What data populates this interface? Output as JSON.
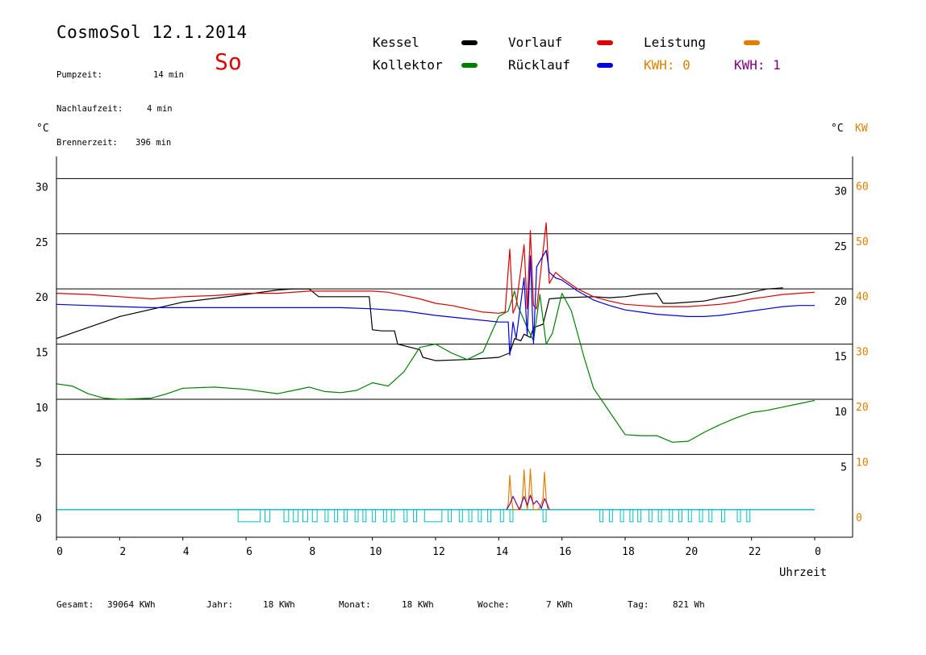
{
  "header": {
    "title": "CosmoSol 12.1.2014",
    "day": "So",
    "info": [
      {
        "label": "Pumpzeit:",
        "value": "14 min"
      },
      {
        "label": "Nachlaufzeit:",
        "value": "4 min"
      },
      {
        "label": "Brennerzeit:",
        "value": "396 min"
      }
    ]
  },
  "legend": {
    "kessel": "Kessel",
    "kollektor": "Kollektor",
    "vorlauf": "Vorlauf",
    "ruecklauf": "Rücklauf",
    "leistung": "Leistung",
    "kwh0": "KWH: 0",
    "kwh1": "KWH: 1"
  },
  "colors": {
    "kessel": "#000000",
    "kollektor": "#008000",
    "vorlauf": "#e00000",
    "ruecklauf": "#0000e0",
    "leistung": "#e08000",
    "kwh0": "#e08000",
    "kwh1": "#800080",
    "pump": "#00c0c0",
    "grid": "#000000"
  },
  "footer": {
    "gesamt_label": "Gesamt:",
    "gesamt_value": "39064 KWh",
    "jahr_label": "Jahr:",
    "jahr_value": "18 KWh",
    "monat_label": "Monat:",
    "monat_value": "18 KWh",
    "woche_label": "Woche:",
    "woche_value": "7 KWh",
    "tag_label": "Tag:",
    "tag_value": "821 Wh"
  },
  "chart_data": {
    "type": "line",
    "xlabel": "Uhrzeit",
    "ylabel_left": "°C",
    "ylabel_right": "°C",
    "ylabel_right2": "KW",
    "xlim": [
      0,
      24
    ],
    "ylim": [
      -2.5,
      32
    ],
    "x_ticks": [
      0,
      2,
      4,
      6,
      8,
      10,
      12,
      14,
      16,
      18,
      20,
      22,
      24
    ],
    "x_tick_labels": [
      "0",
      "2",
      "4",
      "6",
      "8",
      "10",
      "12",
      "14",
      "16",
      "18",
      "20",
      "22",
      "0"
    ],
    "y_ticks": [
      0,
      5,
      10,
      15,
      20,
      25,
      30
    ],
    "left_tick_labels": [
      "0",
      "5",
      "10",
      "15",
      "20",
      "25",
      "30"
    ],
    "right_tick_labels": [
      "",
      "5",
      "10",
      "15",
      "20",
      "25",
      "30"
    ],
    "kw_tick_labels": [
      "0",
      "10",
      "20",
      "30",
      "40",
      "50",
      "60"
    ],
    "grid": true,
    "series": [
      {
        "name": "Kessel",
        "key": "kessel",
        "x": [
          0,
          2,
          4,
          6,
          7,
          7.5,
          8,
          8.3,
          9,
          9.9,
          10,
          10.3,
          10.7,
          10.8,
          11.5,
          11.6,
          12,
          13,
          13.5,
          14,
          14.35,
          14.5,
          14.7,
          14.8,
          15,
          15.1,
          15.4,
          15.6,
          16,
          17,
          17.5,
          18,
          18.5,
          19,
          19.2,
          19.5,
          20,
          20.5,
          21,
          21.5,
          22,
          22.5,
          23
        ],
        "y": [
          15.5,
          17.5,
          18.8,
          19.5,
          19.9,
          20.0,
          20.0,
          19.3,
          19.3,
          19.3,
          16.3,
          16.2,
          16.2,
          15.0,
          14.5,
          13.8,
          13.5,
          13.6,
          13.7,
          13.8,
          14.2,
          15.5,
          15.3,
          15.9,
          15.6,
          16.5,
          16.8,
          19.1,
          19.2,
          19.3,
          19.2,
          19.3,
          19.5,
          19.6,
          18.7,
          18.7,
          18.8,
          18.9,
          19.2,
          19.4,
          19.7,
          20.0,
          20.1
        ]
      },
      {
        "name": "Kollektor",
        "key": "kollektor",
        "x": [
          0,
          0.5,
          1,
          1.5,
          2,
          3,
          3.5,
          4,
          5,
          6,
          7,
          7.5,
          8,
          8.5,
          9,
          9.5,
          10,
          10.5,
          11,
          11.5,
          12,
          12.5,
          13,
          13.5,
          14,
          14.3,
          14.5,
          14.6,
          14.9,
          15.1,
          15.3,
          15.5,
          15.7,
          16,
          16.3,
          16.7,
          17,
          17.5,
          18,
          18.5,
          19,
          19.5,
          20,
          20.5,
          21,
          21.5,
          22,
          22.5,
          23,
          23.5,
          24
        ],
        "y": [
          11.4,
          11.2,
          10.5,
          10.1,
          10.0,
          10.1,
          10.5,
          11.0,
          11.1,
          10.9,
          10.5,
          10.8,
          11.1,
          10.7,
          10.6,
          10.8,
          11.5,
          11.2,
          12.5,
          14.7,
          15.0,
          14.2,
          13.6,
          14.3,
          17.5,
          18.0,
          19.8,
          18.5,
          16.5,
          15.3,
          19.5,
          15.0,
          16.0,
          19.6,
          18.0,
          13.8,
          11.0,
          8.9,
          6.8,
          6.7,
          6.7,
          6.1,
          6.2,
          7.0,
          7.7,
          8.3,
          8.8,
          9.0,
          9.3,
          9.6,
          9.9
        ]
      },
      {
        "name": "Vorlauf",
        "key": "vorlauf",
        "x": [
          0,
          1,
          2,
          3,
          4,
          5,
          6,
          7,
          8,
          9,
          10,
          10.5,
          11,
          11.5,
          12,
          12.5,
          13,
          13.5,
          14,
          14.2,
          14.35,
          14.45,
          14.55,
          14.8,
          14.9,
          15.0,
          15.1,
          15.2,
          15.5,
          15.6,
          15.8,
          16,
          16.5,
          17,
          17.5,
          18,
          18.5,
          19,
          19.5,
          20,
          20.5,
          21,
          21.5,
          22,
          22.5,
          23,
          23.5,
          24
        ],
        "y": [
          19.6,
          19.5,
          19.3,
          19.1,
          19.3,
          19.4,
          19.6,
          19.6,
          19.8,
          19.8,
          19.8,
          19.7,
          19.4,
          19.1,
          18.7,
          18.5,
          18.2,
          17.9,
          17.8,
          17.9,
          23.6,
          17.8,
          18.5,
          24.0,
          18.2,
          25.3,
          18.5,
          18.2,
          26.0,
          20.5,
          21.5,
          21.0,
          20.0,
          19.3,
          18.9,
          18.6,
          18.5,
          18.4,
          18.4,
          18.4,
          18.5,
          18.6,
          18.8,
          19.1,
          19.3,
          19.5,
          19.6,
          19.7
        ]
      },
      {
        "name": "Rücklauf",
        "key": "ruecklauf",
        "x": [
          0,
          1,
          2,
          3,
          4,
          5,
          6,
          7,
          8,
          9,
          10,
          11,
          12,
          13,
          14,
          14.3,
          14.35,
          14.45,
          14.55,
          14.8,
          14.9,
          15.0,
          15.1,
          15.2,
          15.5,
          15.6,
          15.8,
          16,
          16.5,
          17,
          17.5,
          18,
          18.5,
          19,
          19.5,
          20,
          20.5,
          21,
          21.5,
          22,
          22.5,
          23,
          23.5,
          24
        ],
        "y": [
          18.6,
          18.5,
          18.4,
          18.3,
          18.3,
          18.3,
          18.3,
          18.3,
          18.3,
          18.3,
          18.2,
          18.0,
          17.6,
          17.3,
          17.0,
          17.0,
          14.0,
          17.0,
          15.5,
          21.0,
          15.8,
          23.0,
          15.0,
          22.0,
          23.5,
          21.5,
          21.0,
          20.8,
          19.8,
          19.0,
          18.5,
          18.1,
          17.9,
          17.7,
          17.6,
          17.5,
          17.5,
          17.6,
          17.8,
          18.0,
          18.2,
          18.4,
          18.5,
          18.5
        ]
      },
      {
        "name": "Leistung",
        "key": "leistung",
        "x": [
          14.25,
          14.3,
          14.35,
          14.4,
          14.45,
          14.6,
          14.7,
          14.75,
          14.8,
          14.85,
          14.9,
          14.95,
          15.0,
          15.05,
          15.1,
          15.15,
          15.25,
          15.35,
          15.4,
          15.45,
          15.5,
          15.55,
          15.6
        ],
        "y": [
          0,
          0.5,
          3.1,
          1.0,
          0,
          0,
          0,
          1.0,
          3.6,
          1.3,
          0,
          1.0,
          3.7,
          1.3,
          0,
          0,
          0,
          0.5,
          1.0,
          3.4,
          1.0,
          0,
          0
        ]
      },
      {
        "name": "KWH: 1",
        "key": "kwh1",
        "x": [
          14.25,
          14.35,
          14.45,
          14.55,
          14.65,
          14.75,
          14.8,
          14.9,
          15.0,
          15.05,
          15.1,
          15.2,
          15.3,
          15.35,
          15.4,
          15.45,
          15.55,
          15.6
        ],
        "y": [
          0,
          0.5,
          1.2,
          0.6,
          0,
          0.8,
          1.2,
          0.4,
          1.3,
          0.9,
          0.5,
          0.8,
          0.4,
          0.1,
          0.6,
          1.0,
          0.4,
          0
        ]
      }
    ],
    "pump_baseline": {
      "key": "pump",
      "y": 0,
      "x_range": [
        0,
        24
      ]
    },
    "pump_pulses": [
      [
        5.75,
        6.45
      ],
      [
        6.6,
        6.75
      ],
      [
        7.2,
        7.35
      ],
      [
        7.5,
        7.65
      ],
      [
        7.8,
        7.95
      ],
      [
        8.1,
        8.25
      ],
      [
        8.5,
        8.6
      ],
      [
        8.8,
        8.9
      ],
      [
        9.1,
        9.2
      ],
      [
        9.45,
        9.55
      ],
      [
        9.7,
        9.8
      ],
      [
        10.0,
        10.1
      ],
      [
        10.35,
        10.45
      ],
      [
        10.6,
        10.7
      ],
      [
        11.0,
        11.1
      ],
      [
        11.3,
        11.4
      ],
      [
        11.65,
        12.2
      ],
      [
        12.4,
        12.5
      ],
      [
        12.75,
        12.85
      ],
      [
        13.05,
        13.15
      ],
      [
        13.35,
        13.45
      ],
      [
        13.65,
        13.75
      ],
      [
        14.05,
        14.15
      ],
      [
        14.35,
        14.45
      ],
      [
        15.4,
        15.5
      ],
      [
        17.2,
        17.3
      ],
      [
        17.5,
        17.6
      ],
      [
        17.85,
        17.95
      ],
      [
        18.15,
        18.25
      ],
      [
        18.4,
        18.5
      ],
      [
        18.75,
        18.85
      ],
      [
        19.05,
        19.15
      ],
      [
        19.4,
        19.5
      ],
      [
        19.7,
        19.8
      ],
      [
        20.0,
        20.1
      ],
      [
        20.35,
        20.45
      ],
      [
        20.65,
        20.75
      ],
      [
        21.05,
        21.15
      ],
      [
        21.55,
        21.65
      ],
      [
        21.85,
        21.95
      ]
    ]
  }
}
